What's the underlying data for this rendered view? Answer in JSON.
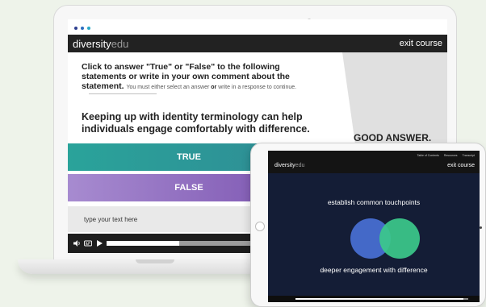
{
  "colors": {
    "browser_dots": [
      "#2d3e8f",
      "#2b6cc0",
      "#2aa9c7"
    ],
    "true_option": "#2aa39a",
    "false_option": "#8f6bc2",
    "venn_left": "#4469c8",
    "venn_right": "#3cc98b"
  },
  "laptop": {
    "header": {
      "logo_part1": "diversity",
      "logo_part2": "edu",
      "exit_label": "exit course"
    },
    "instructions": {
      "bold_text": "Click to answer \"True\" or \"False\" to the following statements or write in your own comment about the statement.",
      "note_prefix": "You must either select an answer",
      "note_or": "or",
      "note_suffix": "write in a response to continue."
    },
    "statement": "Keeping up with identity terminology can help individuals engage comfortably with difference.",
    "feedback": "GOOD ANSWER.",
    "options": {
      "true_label": "TRUE",
      "false_label": "FALSE"
    },
    "text_input_placeholder": "type your text here",
    "player": {
      "progress": 0.45,
      "icons": [
        "volume-icon",
        "captions-icon",
        "play-icon"
      ]
    }
  },
  "tablet": {
    "header": {
      "logo_part1": "diversity",
      "logo_part2": "edu",
      "menu": [
        "Table of Contents",
        "Resources",
        "Transcript"
      ],
      "exit_label": "exit course"
    },
    "heading": "establish common touchpoints",
    "caption": "deeper engagement with difference",
    "player": {
      "progress": 0.97
    }
  }
}
